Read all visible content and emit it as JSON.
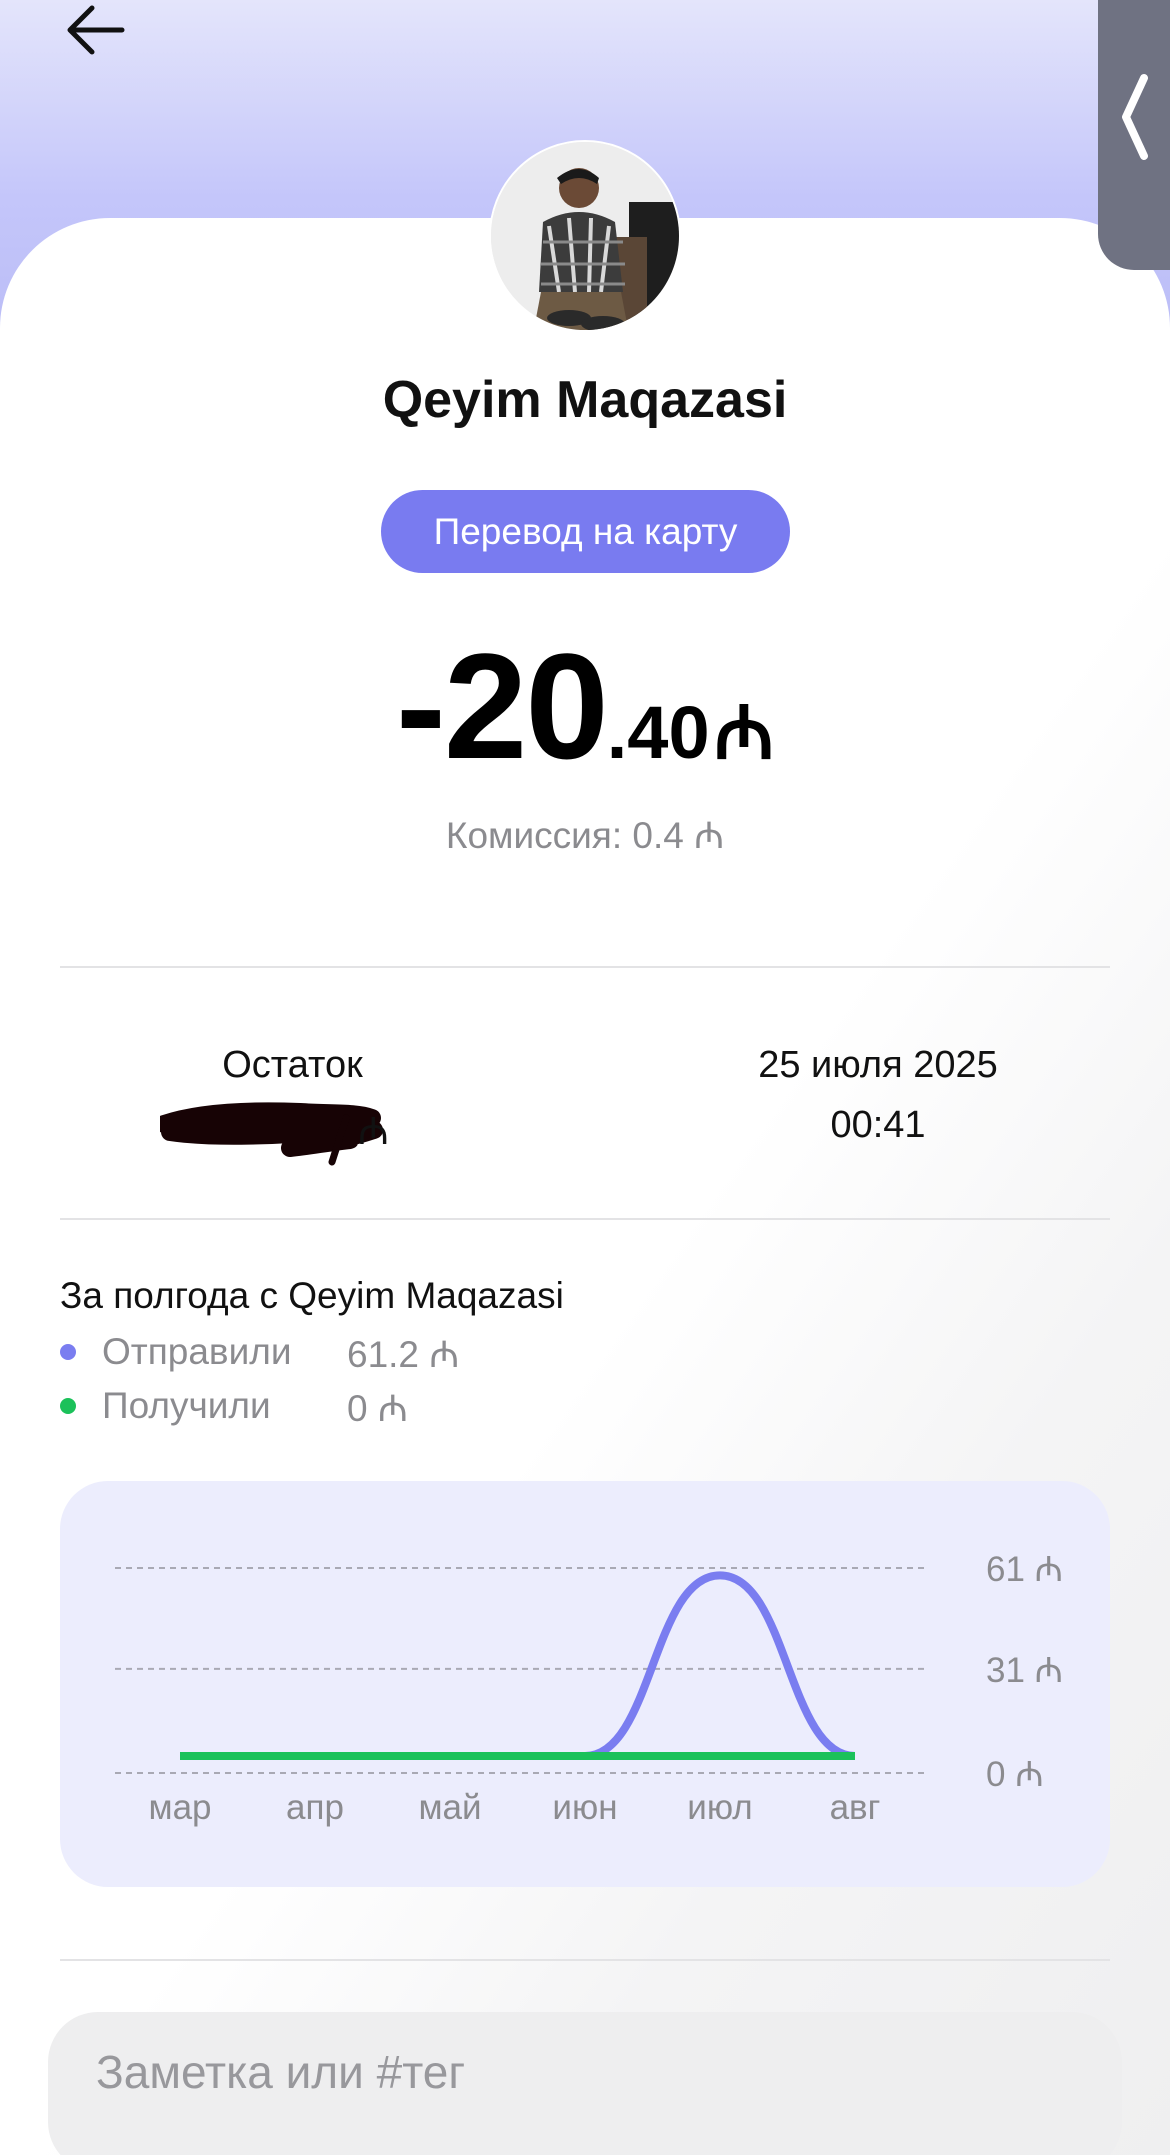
{
  "colors": {
    "accent": "#797bf0",
    "sent": "#7a7df0",
    "received": "#1bc15a",
    "muted_text": "#8b8b8f",
    "chart_bg": "#ecedfd"
  },
  "header": {
    "back_icon": "arrow-left-icon",
    "side_tab_icon": "chevron-left-icon"
  },
  "merchant": {
    "name": "Qeyim Maqazasi",
    "avatar": "merchant-avatar-photo",
    "type_label": "Перевод на карту"
  },
  "amount": {
    "integer": "-20",
    "fraction": ".40",
    "currency": "₼"
  },
  "fee": "Комиссия: 0.4 ₼",
  "details": {
    "balance_label": "Остаток",
    "balance_currency": "₼",
    "date": "25 июля 2025",
    "time": "00:41"
  },
  "summary": {
    "title": "За полгода с Qeyim Maqazasi",
    "sent_label": "Отправили",
    "sent_value": "61.2 ₼",
    "received_label": "Получили",
    "received_value": "0 ₼"
  },
  "chart_data": {
    "type": "line",
    "categories": [
      "мар",
      "апр",
      "май",
      "июн",
      "июл",
      "авг"
    ],
    "y_tick_labels": [
      "61 ₼",
      "31 ₼",
      "0 ₼"
    ],
    "y_ticks": [
      61,
      31,
      0
    ],
    "ylim": [
      0,
      61
    ],
    "grid": true,
    "series": [
      {
        "name": "Отправили",
        "color": "#7a7df0",
        "values": [
          0,
          0,
          0,
          0,
          61.2,
          0
        ]
      },
      {
        "name": "Получили",
        "color": "#1bc15a",
        "values": [
          0,
          0,
          0,
          0,
          0,
          0
        ]
      }
    ]
  },
  "note": {
    "placeholder": "Заметка или #тег",
    "value": ""
  }
}
